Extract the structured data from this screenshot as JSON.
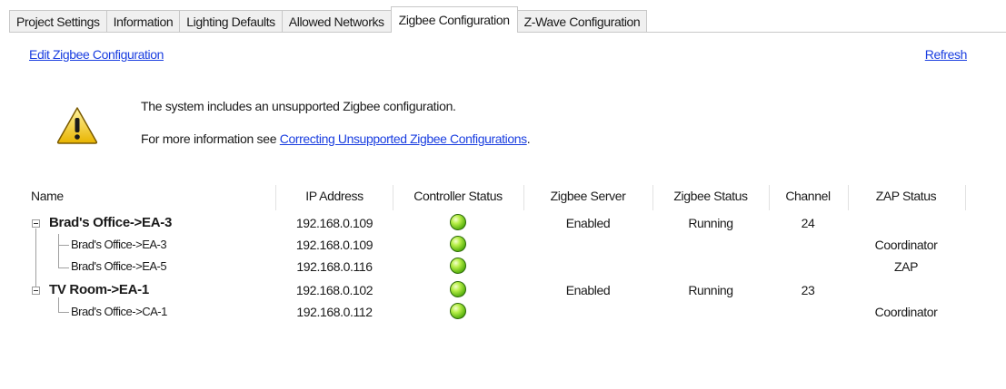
{
  "tabs": [
    {
      "label": "Project Settings",
      "active": false
    },
    {
      "label": "Information",
      "active": false
    },
    {
      "label": "Lighting Defaults",
      "active": false
    },
    {
      "label": "Allowed Networks",
      "active": false
    },
    {
      "label": "Zigbee Configuration",
      "active": true
    },
    {
      "label": "Z-Wave Configuration",
      "active": false
    }
  ],
  "edit_link": "Edit Zigbee Configuration",
  "refresh_link": "Refresh",
  "warning": {
    "icon": "warning-triangle-icon",
    "line1": "The system includes an unsupported Zigbee configuration.",
    "line2_prefix": "For more information see ",
    "line2_link": "Correcting Unsupported Zigbee Configurations",
    "line2_suffix": "."
  },
  "columns": [
    "Name",
    "IP Address",
    "Controller Status",
    "Zigbee Server",
    "Zigbee Status",
    "Channel",
    "ZAP Status"
  ],
  "status_color": "#7ccf1f",
  "rows": [
    {
      "name": "Brad's Office->EA-3",
      "ip": "192.168.0.109",
      "status": "green",
      "server": "Enabled",
      "zigbee_status": "Running",
      "channel": "24",
      "zap": ""
    },
    {
      "name": "Brad's Office->EA-3",
      "ip": "192.168.0.109",
      "status": "green",
      "server": "",
      "zigbee_status": "",
      "channel": "",
      "zap": "Coordinator"
    },
    {
      "name": "Brad's Office->EA-5",
      "ip": "192.168.0.116",
      "status": "green",
      "server": "",
      "zigbee_status": "",
      "channel": "",
      "zap": "ZAP"
    },
    {
      "name": "TV Room->EA-1",
      "ip": "192.168.0.102",
      "status": "green",
      "server": "Enabled",
      "zigbee_status": "Running",
      "channel": "23",
      "zap": ""
    },
    {
      "name": "Brad's Office->CA-1",
      "ip": "192.168.0.112",
      "status": "green",
      "server": "",
      "zigbee_status": "",
      "channel": "",
      "zap": "Coordinator"
    }
  ]
}
